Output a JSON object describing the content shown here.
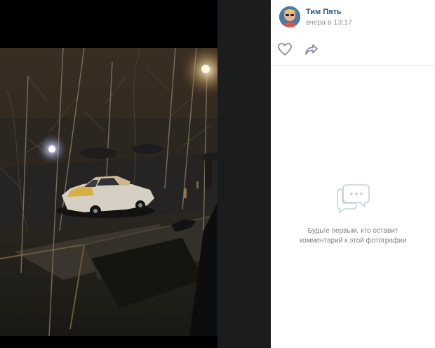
{
  "post": {
    "author_name": "Тим Пять",
    "date": "вчера в 13:17"
  },
  "actions": {
    "like_icon": "heart-icon",
    "share_icon": "share-icon"
  },
  "comments": {
    "empty_icon": "comments-icon",
    "empty_line1": "Будьте первым, кто оставит",
    "empty_line2": "комментарий к этой фотографии"
  },
  "colors": {
    "link": "#2a5885",
    "muted": "#939393",
    "icon": "#828a99",
    "divider": "#e7e8ec",
    "viewer_bg": "#000000"
  }
}
